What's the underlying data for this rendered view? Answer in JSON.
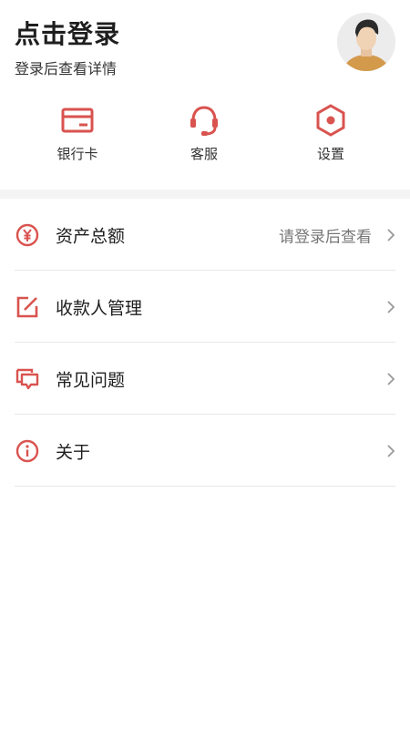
{
  "header": {
    "title": "点击登录",
    "subtitle": "登录后查看详情"
  },
  "quick_actions": [
    {
      "label": "银行卡",
      "icon": "bank-card-icon"
    },
    {
      "label": "客服",
      "icon": "customer-service-headset-icon"
    },
    {
      "label": "设置",
      "icon": "settings-hexagon-icon"
    }
  ],
  "menu": [
    {
      "label": "资产总额",
      "value": "请登录后查看",
      "icon": "yuan-circle-icon"
    },
    {
      "label": "收款人管理",
      "value": "",
      "icon": "edit-square-icon"
    },
    {
      "label": "常见问题",
      "value": "",
      "icon": "chat-bubbles-icon"
    },
    {
      "label": "关于",
      "value": "",
      "icon": "info-circle-icon"
    }
  ],
  "colors": {
    "accent": "#d9534f",
    "divider": "#e8e8e8",
    "band": "#f4f4f4",
    "chevron": "#9a9a9a"
  }
}
